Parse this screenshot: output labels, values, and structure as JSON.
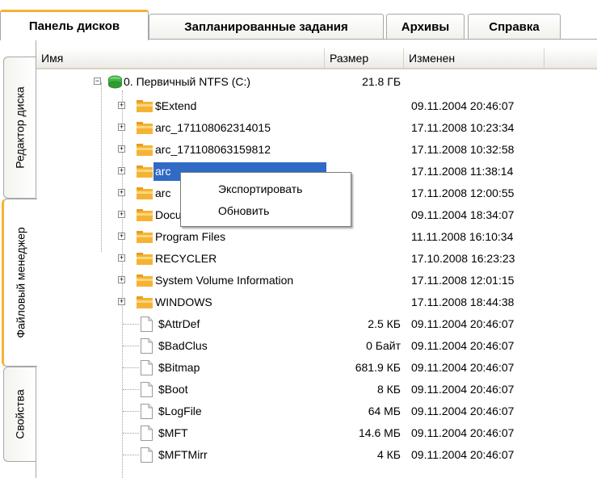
{
  "top_tabs": [
    {
      "label": "Панель дисков",
      "active": true
    },
    {
      "label": "Запланированные задания",
      "active": false
    },
    {
      "label": "Архивы",
      "active": false
    },
    {
      "label": "Справка",
      "active": false
    }
  ],
  "side_tabs": [
    {
      "label": "Редактор диска",
      "active": false
    },
    {
      "label": "Файловый менеджер",
      "active": true
    },
    {
      "label": "Свойства",
      "active": false
    }
  ],
  "columns": {
    "name": "Имя",
    "size": "Размер",
    "modified": "Изменен"
  },
  "root": {
    "name": "0. Первичный NTFS (C:)",
    "size": "21.8 ГБ",
    "icon": "disk-icon"
  },
  "folders": [
    {
      "name": "$Extend",
      "modified": "09.11.2004 20:46:07"
    },
    {
      "name": "arc_171108062314015",
      "modified": "17.11.2008 10:23:34"
    },
    {
      "name": "arc_171108063159812",
      "modified": "17.11.2008 10:32:58"
    },
    {
      "name": "arc",
      "modified": "17.11.2008 11:38:14",
      "selected": true
    },
    {
      "name": "arc",
      "modified": "17.11.2008 12:00:55"
    },
    {
      "name": "Documents and Settings",
      "modified": "09.11.2004 18:34:07"
    },
    {
      "name": "Program Files",
      "modified": "11.11.2008 16:10:34"
    },
    {
      "name": "RECYCLER",
      "modified": "17.10.2008 16:23:23"
    },
    {
      "name": "System Volume Information",
      "modified": "17.11.2008 12:01:15"
    },
    {
      "name": "WINDOWS",
      "modified": "17.11.2008 18:44:38"
    }
  ],
  "files": [
    {
      "name": "$AttrDef",
      "size": "2.5 КБ",
      "modified": "09.11.2004 20:46:07"
    },
    {
      "name": "$BadClus",
      "size": "0 Байт",
      "modified": "09.11.2004 20:46:07"
    },
    {
      "name": "$Bitmap",
      "size": "681.9 КБ",
      "modified": "09.11.2004 20:46:07"
    },
    {
      "name": "$Boot",
      "size": "8 КБ",
      "modified": "09.11.2004 20:46:07"
    },
    {
      "name": "$LogFile",
      "size": "64 МБ",
      "modified": "09.11.2004 20:46:07"
    },
    {
      "name": "$MFT",
      "size": "14.6 МБ",
      "modified": "09.11.2004 20:46:07"
    },
    {
      "name": "$MFTMirr",
      "size": "4 КБ",
      "modified": "09.11.2004 20:46:07"
    }
  ],
  "context_menu": [
    {
      "label": "Экспортировать"
    },
    {
      "label": "Обновить"
    }
  ],
  "colors": {
    "accent_tab": "#f5b335",
    "selection": "#316ac5",
    "folder": "#f5b335"
  }
}
